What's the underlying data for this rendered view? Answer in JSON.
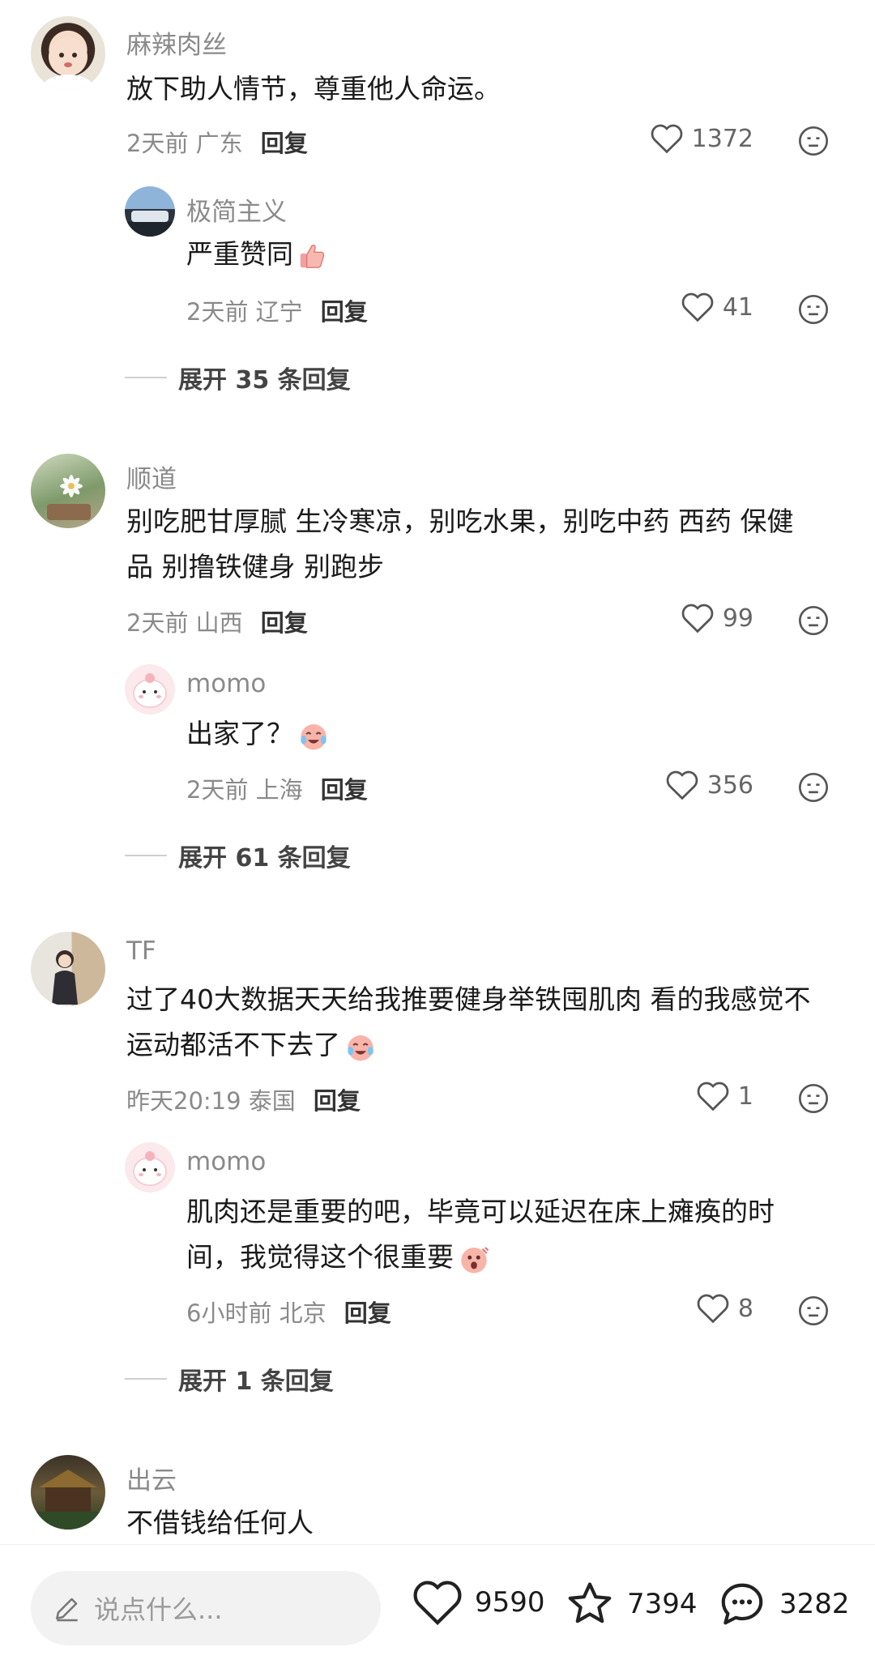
{
  "comments": [
    {
      "user": "麻辣肉丝",
      "text": "放下助人情节，尊重他人命运。",
      "time": "2天前",
      "location": "广东",
      "reply_label": "回复",
      "likes": "1372",
      "sub": {
        "user": "极简主义",
        "text": "严重赞同",
        "time": "2天前",
        "location": "辽宁",
        "reply_label": "回复",
        "likes": "41"
      },
      "expand": "展开 35 条回复"
    },
    {
      "user": "顺道",
      "text_line1": "别吃肥甘厚腻 生冷寒凉，别吃水果，别吃中药 西药 保健",
      "text_line2": "品 别撸铁健身 别跑步",
      "time": "2天前",
      "location": "山西",
      "reply_label": "回复",
      "likes": "99",
      "sub": {
        "user": "momo",
        "text": "出家了？",
        "time": "2天前",
        "location": "上海",
        "reply_label": "回复",
        "likes": "356"
      },
      "expand": "展开 61 条回复"
    },
    {
      "user": "TF",
      "text_line1": "过了40大数据天天给我推要健身举铁囤肌肉 看的我感觉不",
      "text_line2": "运动都活不下去了",
      "time": "昨天20:19",
      "location": "泰国",
      "reply_label": "回复",
      "likes": "1",
      "sub": {
        "user": "momo",
        "text_line1": "肌肉还是重要的吧，毕竟可以延迟在床上瘫痪的时",
        "text_line2": "间，我觉得这个很重要",
        "time": "6小时前",
        "location": "北京",
        "reply_label": "回复",
        "likes": "8"
      },
      "expand": "展开 1 条回复"
    },
    {
      "user": "出云",
      "text": "不借钱给任何人"
    }
  ],
  "bottom_bar": {
    "input_placeholder": "说点什么...",
    "likes": "9590",
    "favorites": "7394",
    "comments": "3282"
  },
  "icons": {
    "like": "heart-outline-icon",
    "dislike": "neutral-face-icon",
    "favorite": "star-outline-icon",
    "comment": "chat-bubble-icon",
    "edit": "pencil-icon"
  },
  "colors": {
    "text_primary": "#1a1a1a",
    "text_secondary": "#8a8a8a",
    "background": "#ffffff"
  }
}
